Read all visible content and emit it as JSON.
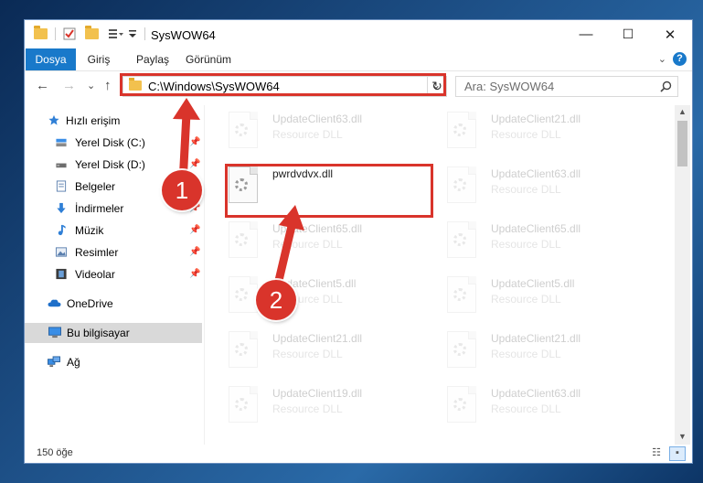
{
  "window": {
    "title": "SysWOW64",
    "controls": {
      "minimize": "—",
      "maximize": "☐",
      "close": "✕"
    }
  },
  "ribbon": {
    "tabs": [
      "Dosya",
      "Giriş",
      "Paylaş",
      "Görünüm"
    ],
    "help": "?"
  },
  "nav": {
    "back": "←",
    "forward": "→",
    "recent": "⌄",
    "up": "↑",
    "address": "C:\\Windows\\SysWOW64",
    "refresh": "↻",
    "search_placeholder": "Ara: SysWOW64"
  },
  "sidebar": {
    "items": [
      {
        "label": "Hızlı erişim",
        "icon": "star-icon",
        "pinned": false,
        "selected": false
      },
      {
        "label": "Yerel Disk (C:)",
        "icon": "drive-icon",
        "pinned": true,
        "selected": false
      },
      {
        "label": "Yerel Disk (D:)",
        "icon": "drive-icon",
        "pinned": true,
        "selected": false
      },
      {
        "label": "Belgeler",
        "icon": "documents-icon",
        "pinned": true,
        "selected": false
      },
      {
        "label": "İndirmeler",
        "icon": "downloads-icon",
        "pinned": true,
        "selected": false
      },
      {
        "label": "Müzik",
        "icon": "music-icon",
        "pinned": true,
        "selected": false
      },
      {
        "label": "Resimler",
        "icon": "pictures-icon",
        "pinned": true,
        "selected": false
      },
      {
        "label": "Videolar",
        "icon": "videos-icon",
        "pinned": true,
        "selected": false
      },
      {
        "label": "OneDrive",
        "icon": "cloud-icon",
        "pinned": false,
        "selected": false
      },
      {
        "label": "Bu bilgisayar",
        "icon": "computer-icon",
        "pinned": false,
        "selected": true
      },
      {
        "label": "Ağ",
        "icon": "network-icon",
        "pinned": false,
        "selected": false
      }
    ]
  },
  "files": {
    "left": [
      {
        "name": "UpdateClient63.dll",
        "type": "Resource DLL"
      },
      {
        "name": "pwrdvdvx.dll",
        "type": ""
      },
      {
        "name": "UpdateClient65.dll",
        "type": "Resource DLL"
      },
      {
        "name": "UpdateClient5.dll",
        "type": "Resource DLL"
      },
      {
        "name": "UpdateClient21.dll",
        "type": "Resource DLL"
      },
      {
        "name": "UpdateClient19.dll",
        "type": "Resource DLL"
      }
    ],
    "right": [
      {
        "name": "UpdateClient21.dll",
        "type": "Resource DLL"
      },
      {
        "name": "UpdateClient63.dll",
        "type": "Resource DLL"
      },
      {
        "name": "UpdateClient65.dll",
        "type": "Resource DLL"
      },
      {
        "name": "UpdateClient5.dll",
        "type": "Resource DLL"
      },
      {
        "name": "UpdateClient21.dll",
        "type": "Resource DLL"
      },
      {
        "name": "UpdateClient63.dll",
        "type": "Resource DLL"
      }
    ]
  },
  "status": {
    "count": "150 öğe"
  },
  "callouts": {
    "step1": "1",
    "step2": "2",
    "color": "#d9342b"
  }
}
